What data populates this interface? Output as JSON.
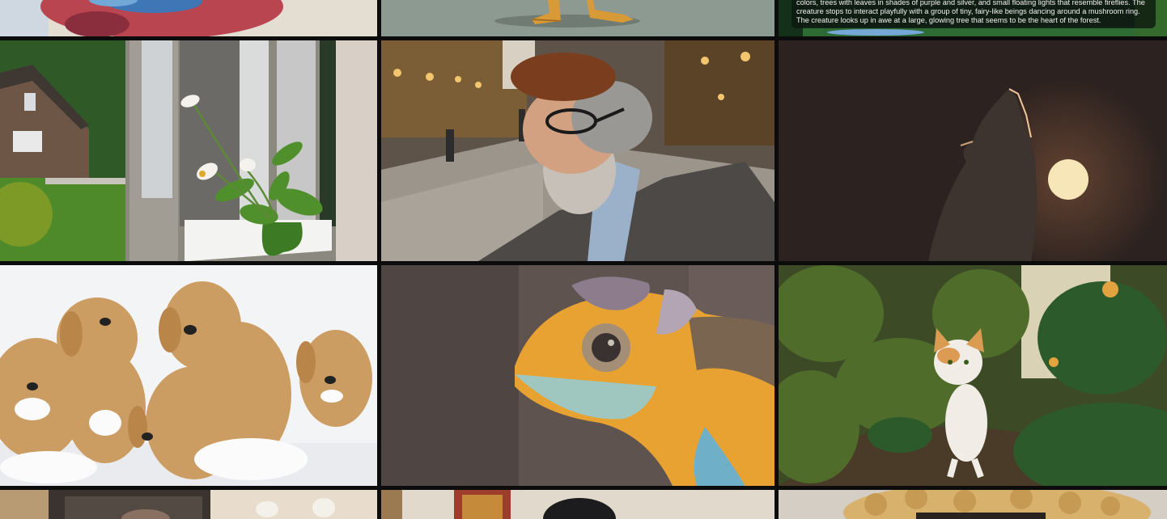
{
  "gallery": {
    "caption_text": "colors, trees with leaves in shades of purple and silver, and small floating lights that resemble fireflies. The creature stops to interact playfully with a group of tiny, fairy-like beings dancing around a mushroom ring. The creature looks up in awe at a large, glowing tree that seems to be the heart of the forest.",
    "tiles": [
      {
        "subject": "bird",
        "icon": "bird-icon"
      },
      {
        "subject": "cartoon-feet",
        "icon": "character-icon"
      },
      {
        "subject": "fantasy-forest",
        "icon": "forest-icon"
      },
      {
        "subject": "flower-pot-on-windowsill",
        "icon": "flower-icon"
      },
      {
        "subject": "bearded-man-with-glasses",
        "icon": "person-icon"
      },
      {
        "subject": "howling-wolf-moon",
        "icon": "wolf-icon"
      },
      {
        "subject": "puppies-in-snow",
        "icon": "dog-icon"
      },
      {
        "subject": "chameleon",
        "icon": "lizard-icon"
      },
      {
        "subject": "cat-in-garden",
        "icon": "cat-icon"
      },
      {
        "subject": "kitchen",
        "icon": "kitchen-icon"
      },
      {
        "subject": "person-indoors",
        "icon": "person-icon"
      },
      {
        "subject": "curly-hair",
        "icon": "hair-icon"
      }
    ],
    "colors": {
      "gutter": "#0c0c0c",
      "caption_bg": "#0c160e",
      "moon": "#f7e6b8",
      "chameleon_orange": "#e8a232"
    }
  }
}
